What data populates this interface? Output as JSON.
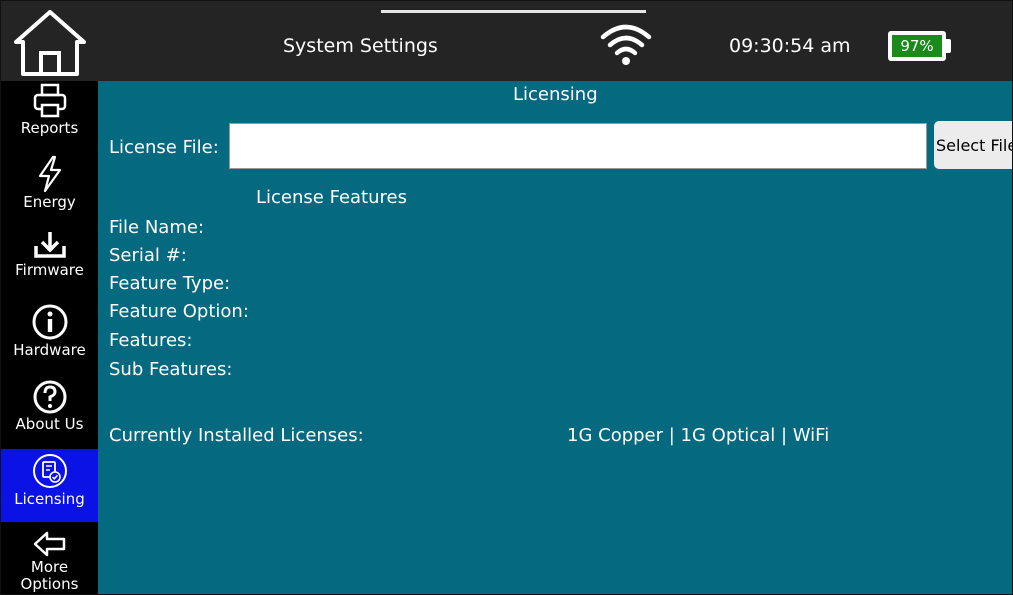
{
  "header": {
    "title": "System Settings",
    "time": "09:30:54 am",
    "battery": "97%",
    "battery_color": "#1a8a1a"
  },
  "sidebar": {
    "items": [
      {
        "label": "Reports",
        "icon": "printer-icon"
      },
      {
        "label": "Energy",
        "icon": "lightning-icon"
      },
      {
        "label": "Firmware",
        "icon": "download-icon"
      },
      {
        "label": "Hardware",
        "icon": "info-icon"
      },
      {
        "label": "About Us",
        "icon": "question-icon"
      },
      {
        "label": "Licensing",
        "icon": "license-icon",
        "active": true
      },
      {
        "label": "More Options",
        "icon": "arrow-left-icon"
      }
    ],
    "active_color": "#0b12e6"
  },
  "licensing": {
    "section_title": "Licensing",
    "license_file_label": "License File:",
    "license_file_value": "",
    "select_file_label": "Select File",
    "features_title": "License Features",
    "fields": [
      "File Name:",
      "Serial #:",
      "Feature Type:",
      "Feature Option:",
      "Features:",
      "Sub Features:"
    ],
    "installed_label": "Currently Installed Licenses:",
    "installed_value": "1G Copper | 1G Optical | WiFi"
  },
  "colors": {
    "panel_bg": "#056980",
    "topbar_bg": "#242424",
    "sidebar_bg": "#000000"
  }
}
